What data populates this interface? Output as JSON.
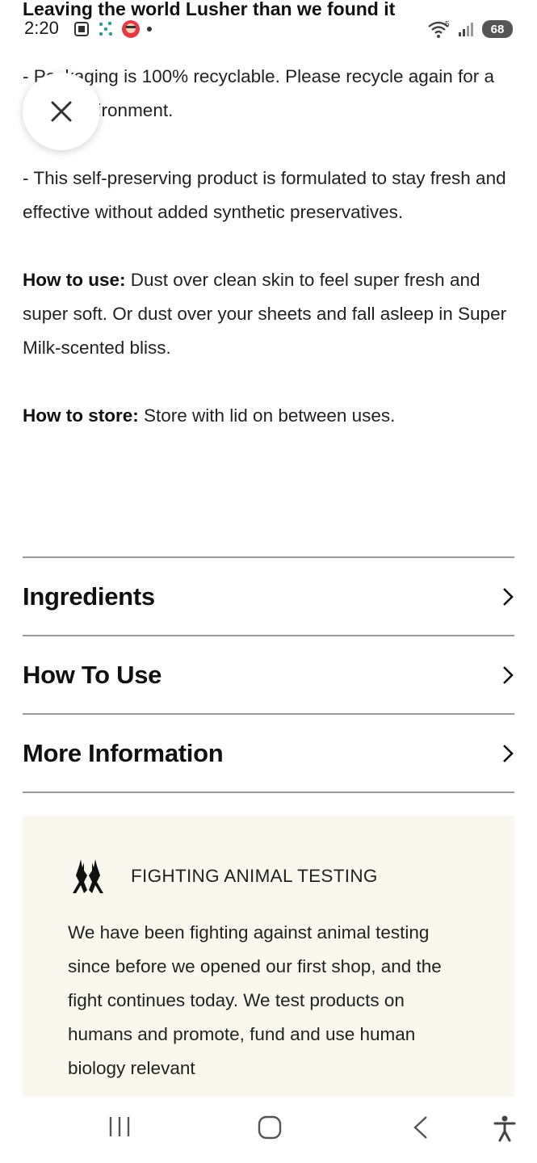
{
  "header": {
    "title": "Leaving the world Lusher than we found it"
  },
  "status_bar": {
    "time": "2:20",
    "battery": "68",
    "wifi_badge": "5"
  },
  "content": {
    "para1": "- Packaging is 100% recyclable. Please recycle again for a fresh environment.",
    "para2": "- This self-preserving product is formulated to stay fresh and effective without added synthetic preservatives.",
    "how_to_use_label": "How to use:",
    "how_to_use_text": " Dust over clean skin to feel super fresh and super soft. Or dust over your sheets and fall asleep in Super Milk-scented bliss.",
    "how_to_store_label": "How to store:",
    "how_to_store_text": " Store with lid on between uses."
  },
  "accordion": [
    {
      "label": "Ingredients"
    },
    {
      "label": "How To Use"
    },
    {
      "label": "More Information"
    }
  ],
  "promo": {
    "title": "FIGHTING ANIMAL TESTING",
    "body": "We have been fighting against animal testing since before we opened our first shop, and the fight continues today. We test products on humans and promote, fund and use human biology relevant"
  },
  "icons": {
    "close": "close-icon",
    "chevron": "chevron-right-icon",
    "hares": "hares-icon",
    "recents": "recents-icon",
    "home": "home-icon",
    "back": "back-icon",
    "accessibility": "accessibility-icon"
  }
}
